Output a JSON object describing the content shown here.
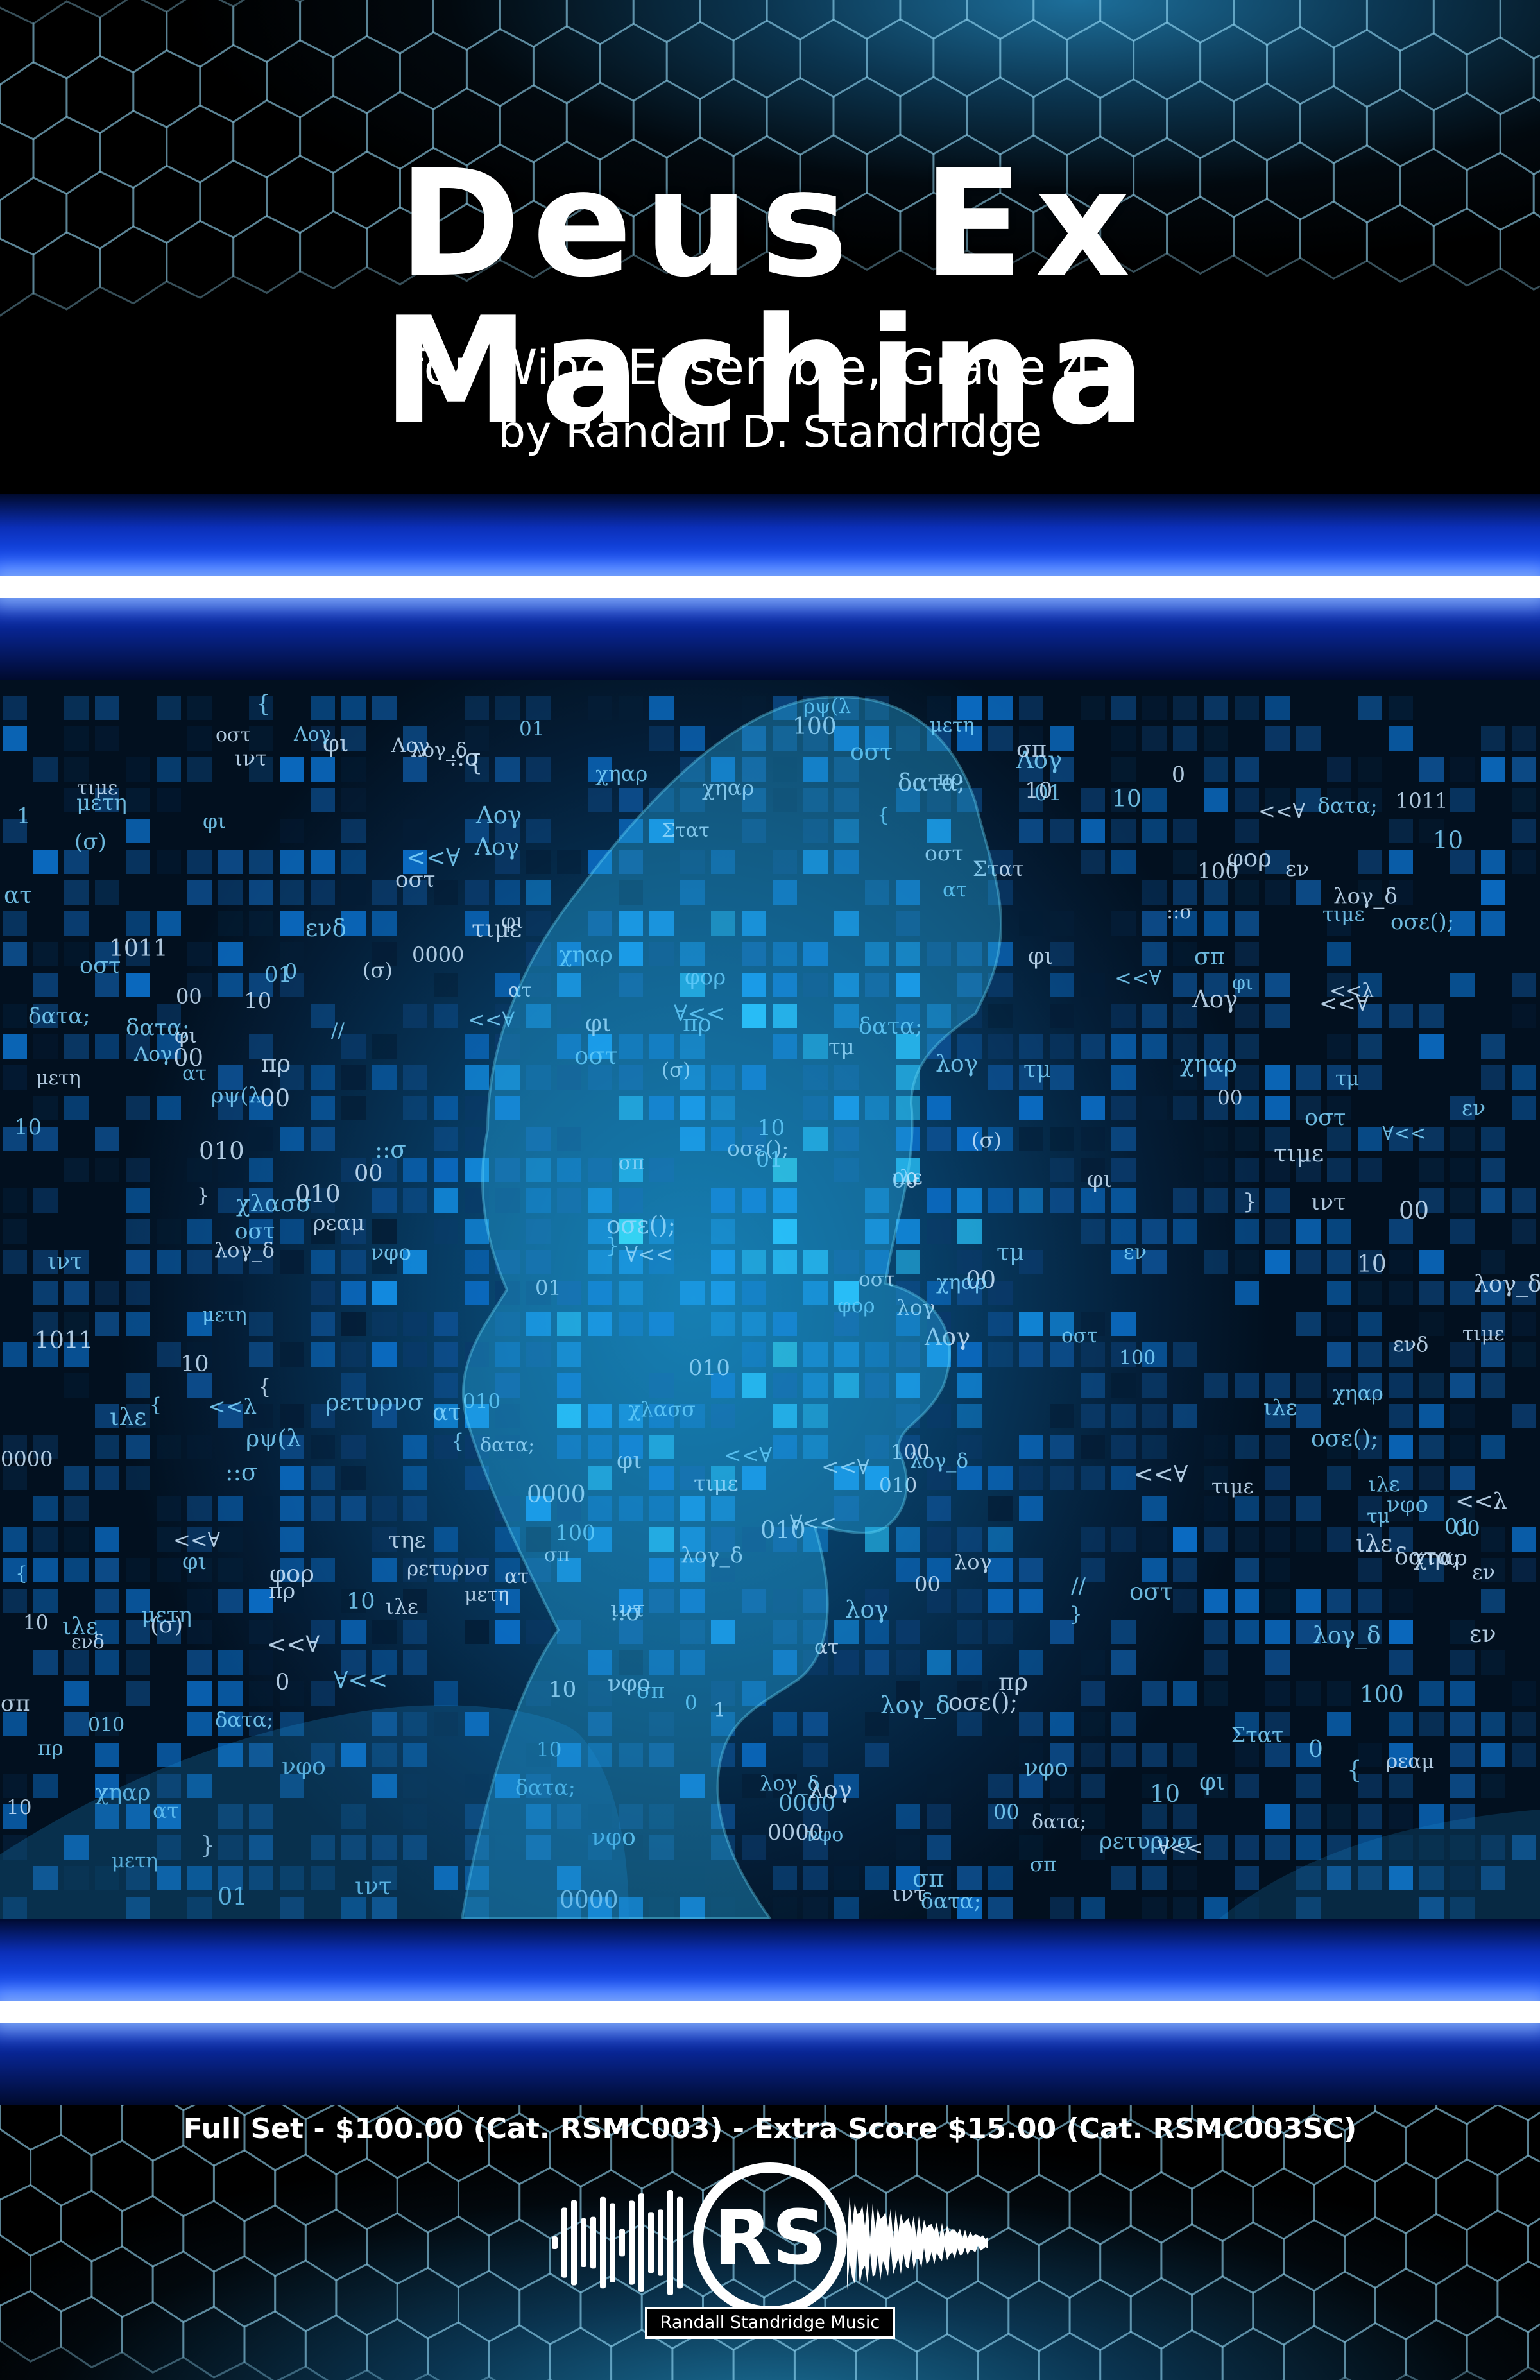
{
  "cover": {
    "title": "Deus Ex Machina",
    "subtitle": "for Wind Ensemble, Grade 4+",
    "composer": "by Randall D. Standridge"
  },
  "pricing": {
    "line": "Full Set - $100.00 (Cat. RSMC003) - Extra Score $15.00 (Cat. RSMC003SC)"
  },
  "publisher": {
    "initials": "RS",
    "name": "Randall Standridge Music"
  },
  "artwork": {
    "glyphs": [
      "τηε",
      "τιμε",
      "σπ",
      "νφο",
      "ατ",
      "οστ",
      "φορ",
      "δατα;",
      "λογ",
      "ιντ",
      "00",
      "01",
      "10",
      "100",
      "1011",
      "0000",
      "<<∀",
      "∀<<",
      "//",
      "εν",
      "ενδ",
      "φι",
      "μετη",
      "χηαρ",
      "ρψ(λ",
      "τμ",
      "ιλε",
      "πρ",
      "ρεαμ",
      "οσε();",
      "Στατ",
      "ρετυρνσ",
      "χλασσ",
      "(σ)",
      "}",
      "{",
      "::σ",
      "<<λ",
      "λογ_δ",
      "Λογ",
      "010",
      "1",
      "0"
    ],
    "colors": {
      "deep": "#041d36",
      "mid": "#0b6fc9",
      "bright": "#29c7ff",
      "cyan": "#3ff0ff"
    }
  }
}
